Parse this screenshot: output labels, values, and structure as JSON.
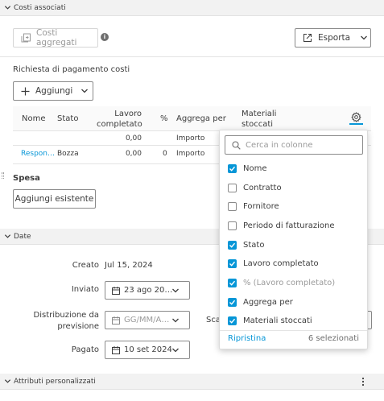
{
  "sections": {
    "costs": "Costi associati",
    "date": "Date",
    "custom": "Attributi personalizzati"
  },
  "toolbar": {
    "aggregated_costs": "Costi aggregati",
    "export": "Esporta"
  },
  "payment_request": {
    "title": "Richiesta di pagamento costi",
    "add": "Aggiungi"
  },
  "table": {
    "headers": {
      "name": "Nome",
      "status": "Stato",
      "work_done_1": "Lavoro",
      "work_done_2": "completato",
      "percent": "%",
      "aggregate_by": "Aggrega per",
      "stored_materials_1": "Materiali",
      "stored_materials_2": "stoccati"
    },
    "summary_row": {
      "work_done": "0,00",
      "aggregate_by": "Importo"
    },
    "rows": [
      {
        "name": "Respon…",
        "status": "Bozza",
        "work_done": "0,00",
        "percent": "0",
        "aggregate_by": "Importo"
      }
    ]
  },
  "expense": {
    "title": "Spesa",
    "add_existing": "Aggiungi esistente"
  },
  "dates": {
    "created_label": "Creato",
    "created_value": "Jul 15, 2024",
    "sent_label": "Inviato",
    "sent_value": "23 ago 20…",
    "forecast_label_1": "Distribuzione da",
    "forecast_label_2": "previsione",
    "forecast_placeholder": "GG/MM/A…",
    "due_label_partial": "Sca",
    "paid_label": "Pagato",
    "paid_value": "10 set 2024"
  },
  "column_picker": {
    "search_placeholder": "Cerca in colonne",
    "options": [
      {
        "label": "Nome",
        "checked": true
      },
      {
        "label": "Contratto",
        "checked": false
      },
      {
        "label": "Fornitore",
        "checked": false
      },
      {
        "label": "Periodo di fatturazione",
        "checked": false
      },
      {
        "label": "Stato",
        "checked": true
      },
      {
        "label": "Lavoro completato",
        "checked": true
      },
      {
        "label": "% (Lavoro completato)",
        "checked": true,
        "muted": true
      },
      {
        "label": "Aggrega per",
        "checked": true
      },
      {
        "label": "Materiali stoccati",
        "checked": true
      }
    ],
    "reset": "Ripristina",
    "selected_count": "6 selezionati"
  },
  "colors": {
    "accent": "#0696d7",
    "link": "#0696d7",
    "section_bg": "#f2f2f2"
  }
}
